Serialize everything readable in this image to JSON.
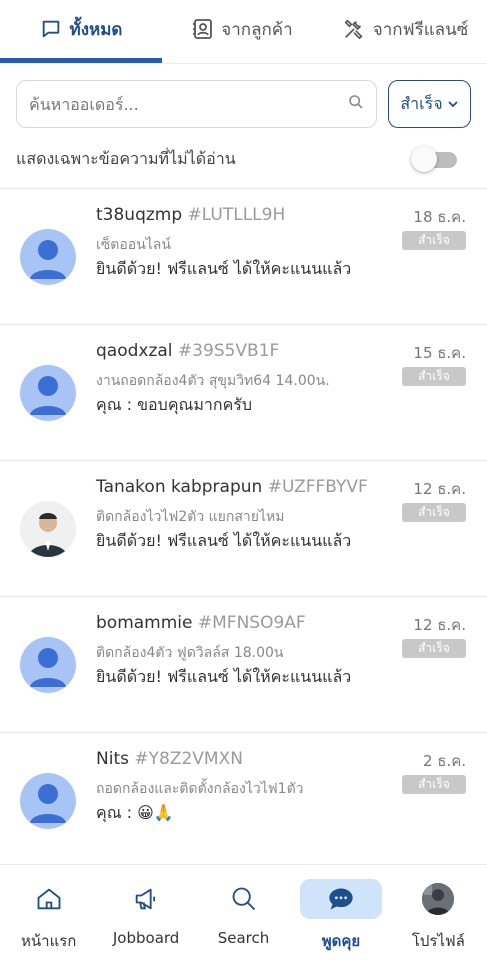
{
  "tabs": [
    {
      "label": "ทั้งหมด",
      "icon": "chat-bubble-icon",
      "active": true
    },
    {
      "label": "จากลูกค้า",
      "icon": "contact-card-icon",
      "active": false
    },
    {
      "label": "จากฟรีแลนซ์",
      "icon": "tools-icon",
      "active": false
    }
  ],
  "search": {
    "placeholder": "ค้นหาออเดอร์..."
  },
  "status_filter": {
    "selected": "สำเร็จ"
  },
  "unread_filter": {
    "label": "แสดงเฉพาะข้อความที่ไม่ได้อ่าน",
    "on": false
  },
  "chats": [
    {
      "name": "t38uqzmp",
      "code": "#LUTLLL9H",
      "date": "18 ธ.ค.",
      "status": "สำเร็จ",
      "subject": "เซ็ตออนไลน์",
      "message": "ยินดีด้วย! ฟรีแลนซ์ ได้ให้คะแนนแล้ว",
      "avatar": "default"
    },
    {
      "name": "qaodxzal",
      "code": "#39S5VB1F",
      "date": "15 ธ.ค.",
      "status": "สำเร็จ",
      "subject": "งานถอดกล้อง4ตัว สุขุมวิท64 14.00น.",
      "message": "คุณ : ขอบคุณมากครับ",
      "avatar": "default"
    },
    {
      "name": "Tanakon kabprapun",
      "code": "#UZFFBYVF",
      "date": "12 ธ.ค.",
      "status": "สำเร็จ",
      "subject": "ติดกล้องไวไฟ2ตัว แยกสายไหม",
      "message": "ยินดีด้วย! ฟรีแลนซ์ ได้ให้คะแนนแล้ว",
      "avatar": "photo"
    },
    {
      "name": "bomammie",
      "code": "#MFNSO9AF",
      "date": "12 ธ.ค.",
      "status": "สำเร็จ",
      "subject": "ติดกล้อง4ตัว ฟูดวิลล์ส 18.00น",
      "message": "ยินดีด้วย! ฟรีแลนซ์ ได้ให้คะแนนแล้ว",
      "avatar": "default"
    },
    {
      "name": "Nits",
      "code": "#Y8Z2VMXN",
      "date": "2 ธ.ค.",
      "status": "สำเร็จ",
      "subject": "ถอดกล้องและติดตั้งกล้องไวไฟ1ตัว",
      "message": "คุณ : 😀🙏",
      "avatar": "default"
    }
  ],
  "bottom_nav": [
    {
      "label": "หน้าแรก",
      "icon": "home-icon",
      "active": false
    },
    {
      "label": "Jobboard",
      "icon": "megaphone-icon",
      "active": false
    },
    {
      "label": "Search",
      "icon": "search-icon",
      "active": false
    },
    {
      "label": "พูดคุย",
      "icon": "chat-icon",
      "active": true
    },
    {
      "label": "โปรไฟล์",
      "icon": "profile-avatar",
      "active": false
    }
  ],
  "colors": {
    "accent": "#1f4e8c",
    "tab_underline": "#1f5fb8",
    "avatar_bg": "#a8c4f5",
    "avatar_fg": "#3c6fd6",
    "badge": "#c8c8c8",
    "nav_active_bg": "#cfe3fb"
  }
}
